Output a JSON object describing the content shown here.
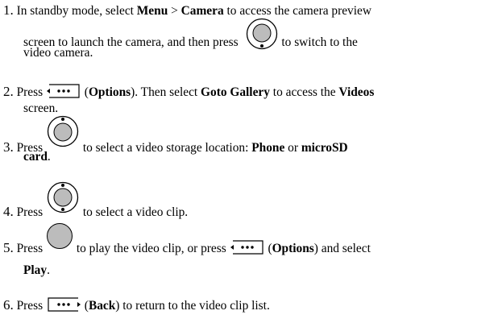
{
  "steps": [
    {
      "number": "1.",
      "t1": "In standby mode, select ",
      "b1": "Menu",
      "t2": " > ",
      "b2": "Camera",
      "t3": " to access the camera preview",
      "t4": "screen to launch the camera, and then press",
      "t5": " to switch to the",
      "t6": "video camera.",
      "icon": "navigation-key-down-icon"
    },
    {
      "number": "2.",
      "t1": "Press ",
      "t2": " (",
      "b1": "Options",
      "t3": "). Then select ",
      "b2": "Goto Gallery",
      "t4": " to access the ",
      "b3": "Videos",
      "t5": "screen.",
      "icon": "left-soft-key-icon"
    },
    {
      "number": "3.",
      "t1": "Press ",
      "t2": " to select a video storage location: ",
      "b1": "Phone",
      "t3": " or ",
      "b2": "microSD",
      "b3": "card",
      "t4": ".",
      "icon": "navigation-key-up-icon"
    },
    {
      "number": "4.",
      "t1": "Press ",
      "t2": " to select a video clip.",
      "icon": "navigation-key-up-down-icon"
    },
    {
      "number": "5.",
      "t1": "Press ",
      "t2": " to play the video clip, or press ",
      "t3": " (",
      "b1": "Options",
      "t4": ") and select",
      "b2": "Play",
      "t5": ".",
      "icons": [
        "center-select-key-icon",
        "left-soft-key-icon"
      ]
    },
    {
      "number": "6.",
      "t1": "Press ",
      "t2": " (",
      "b1": "Back",
      "t3": ") to return to the video clip list.",
      "icon": "right-soft-key-icon"
    }
  ]
}
